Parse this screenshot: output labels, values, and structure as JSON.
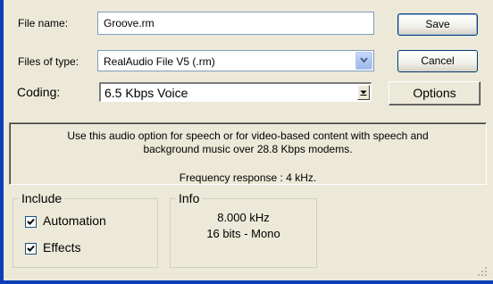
{
  "filename": {
    "label": "File name:",
    "value": "Groove.rm"
  },
  "filetype": {
    "label": "Files of type:",
    "value": "RealAudio File V5 (.rm)"
  },
  "coding": {
    "label": "Coding:",
    "value": "6.5 Kbps Voice"
  },
  "buttons": {
    "save": "Save",
    "cancel": "Cancel",
    "options": "Options"
  },
  "description": {
    "line1": "Use this audio option for speech or for video-based content with speech and",
    "line2": "background music over 28.8 Kbps modems.",
    "frequency": "Frequency response : 4 kHz."
  },
  "include": {
    "title": "Include",
    "automation": {
      "label": "Automation",
      "checked": true
    },
    "effects": {
      "label": "Effects",
      "checked": true
    }
  },
  "info": {
    "title": "Info",
    "rate": "8.000 kHz",
    "format": "16 bits - Mono"
  },
  "colors": {
    "window_border": "#0a3fb8",
    "dialog_bg": "#ece9d8",
    "field_border": "#7f9db9"
  }
}
